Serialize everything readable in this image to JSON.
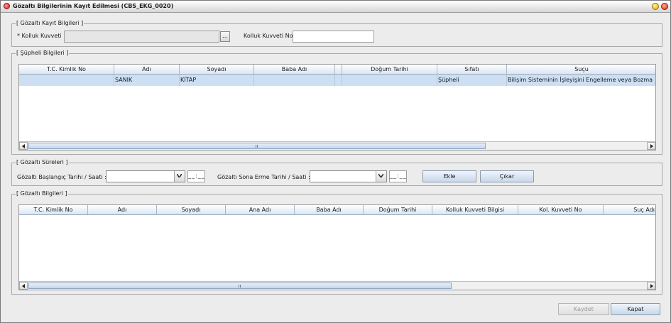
{
  "window": {
    "title": "Gözaltı Bilgilerinin Kayıt Edilmesi (CBS_EKG_0020)"
  },
  "kayit": {
    "legend": "[ Gözaltı Kayıt Bilgileri ]",
    "kolluk_kuvveti_label": "* Kolluk Kuvveti :",
    "kolluk_kuvveti_value": "",
    "browse_label": "...",
    "kolluk_kuvveti_no_label": "Kolluk Kuvveti No :",
    "kolluk_kuvveti_no_value": ""
  },
  "supheli": {
    "legend": "[ Şüpheli Bilgileri ]",
    "columns": [
      "T.C. Kimlik No",
      "Adı",
      "Soyadı",
      "Baba Adı",
      "",
      "Doğum Tarihi",
      "Sıfatı",
      "Suçu"
    ],
    "rows": [
      [
        "",
        "SANIK",
        "KİTAP",
        "",
        "",
        "",
        "Şüpheli",
        "Bilişim Sisteminin İşleyişini Engelleme veya Bozma"
      ]
    ]
  },
  "sureler": {
    "legend": "[ Gözaltı Süreleri ]",
    "baslangic_label": "Gözaltı Başlangıç Tarihi / Saati :",
    "baslangic_value": "",
    "baslangic_time": "__:__",
    "sona_erme_label": "Gözaltı Sona Erme Tarihi / Saati :",
    "sona_erme_value": "",
    "sona_erme_time": "__:__",
    "ekle_label": "Ekle",
    "cikar_label": "Çıkar"
  },
  "gozalti": {
    "legend": "[ Gözaltı Bilgileri ]",
    "columns": [
      "T.C. Kimlik No",
      "Adı",
      "Soyadı",
      "Ana Adı",
      "Baba Adı",
      "Doğum Tarihi",
      "Kolluk Kuvveti Bilgisi",
      "Kol. Kuvveti No",
      "Suç Adı"
    ],
    "rows": []
  },
  "footer": {
    "kaydet_label": "Kaydet",
    "kapat_label": "Kapat"
  },
  "icons": [
    "app-icon",
    "minimize-icon",
    "close-icon",
    "chevron-down-icon",
    "arrow-left-icon",
    "arrow-right-icon"
  ]
}
